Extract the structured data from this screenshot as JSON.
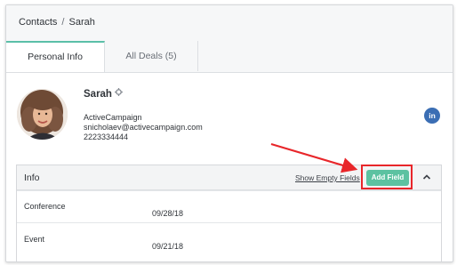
{
  "breadcrumb": {
    "root": "Contacts",
    "separator": "/",
    "current": "Sarah"
  },
  "tabs": [
    {
      "label": "Personal Info",
      "active": true
    },
    {
      "label": "All Deals (5)",
      "active": false
    }
  ],
  "contact": {
    "name": "Sarah",
    "company": "ActiveCampaign",
    "email": "snicholaev@activecampaign.com",
    "phone": "2223334444",
    "linkedin_glyph": "in"
  },
  "info": {
    "title": "Info",
    "show_empty_label": "Show Empty Fields",
    "add_field_label": "Add Field",
    "fields": [
      {
        "label": "Conference",
        "value": "09/28/18"
      },
      {
        "label": "Event",
        "value": "09/21/18"
      }
    ]
  },
  "colors": {
    "accent": "#5bbfa8",
    "add_button": "#5cc2a1",
    "annotation_red": "#e8262a",
    "linkedin": "#3b6eb4"
  },
  "icons": {
    "gear": "gear-icon",
    "linkedin": "linkedin-icon",
    "collapse": "chevron-up-icon",
    "annotation": "arrow-annotation"
  }
}
